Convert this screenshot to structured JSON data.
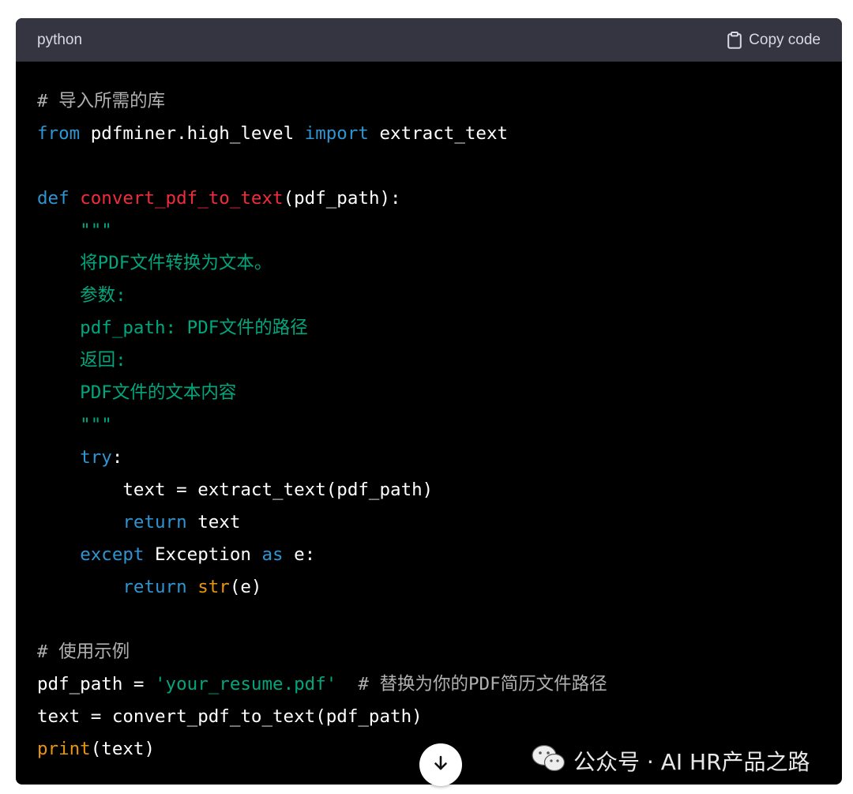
{
  "header": {
    "language": "python",
    "copy_label": "Copy code",
    "copy_icon": "clipboard-icon"
  },
  "code_lines": [
    [
      {
        "t": "# 导入所需的库",
        "c": "cm"
      }
    ],
    [
      {
        "t": "from",
        "c": "kw"
      },
      {
        "t": " pdfminer.high_level ",
        "c": ""
      },
      {
        "t": "import",
        "c": "kw"
      },
      {
        "t": " extract_text",
        "c": ""
      }
    ],
    [],
    [
      {
        "t": "def",
        "c": "kw"
      },
      {
        "t": " ",
        "c": ""
      },
      {
        "t": "convert_pdf_to_text",
        "c": "fn-def"
      },
      {
        "t": "(pdf_path):",
        "c": ""
      }
    ],
    [
      {
        "t": "    \"\"\"",
        "c": "str"
      }
    ],
    [
      {
        "t": "    将PDF文件转换为文本。",
        "c": "str"
      }
    ],
    [
      {
        "t": "    参数:",
        "c": "str"
      }
    ],
    [
      {
        "t": "    pdf_path: PDF文件的路径",
        "c": "str"
      }
    ],
    [
      {
        "t": "    返回:",
        "c": "str"
      }
    ],
    [
      {
        "t": "    PDF文件的文本内容",
        "c": "str"
      }
    ],
    [
      {
        "t": "    \"\"\"",
        "c": "str"
      }
    ],
    [
      {
        "t": "    ",
        "c": ""
      },
      {
        "t": "try",
        "c": "kw"
      },
      {
        "t": ":",
        "c": ""
      }
    ],
    [
      {
        "t": "        text = extract_text(pdf_path)",
        "c": ""
      }
    ],
    [
      {
        "t": "        ",
        "c": ""
      },
      {
        "t": "return",
        "c": "kw"
      },
      {
        "t": " text",
        "c": ""
      }
    ],
    [
      {
        "t": "    ",
        "c": ""
      },
      {
        "t": "except",
        "c": "kw"
      },
      {
        "t": " Exception ",
        "c": ""
      },
      {
        "t": "as",
        "c": "kw"
      },
      {
        "t": " e:",
        "c": ""
      }
    ],
    [
      {
        "t": "        ",
        "c": ""
      },
      {
        "t": "return",
        "c": "kw"
      },
      {
        "t": " ",
        "c": ""
      },
      {
        "t": "str",
        "c": "bi"
      },
      {
        "t": "(e)",
        "c": ""
      }
    ],
    [],
    [
      {
        "t": "# 使用示例",
        "c": "cm"
      }
    ],
    [
      {
        "t": "pdf_path = ",
        "c": ""
      },
      {
        "t": "'your_resume.pdf'",
        "c": "str"
      },
      {
        "t": "  ",
        "c": ""
      },
      {
        "t": "# 替换为你的PDF简历文件路径",
        "c": "cm"
      }
    ],
    [
      {
        "t": "text = convert_pdf_to_text(pdf_path)",
        "c": ""
      }
    ],
    [
      {
        "t": "print",
        "c": "bi"
      },
      {
        "t": "(text)",
        "c": ""
      }
    ]
  ],
  "scroll_button": {
    "icon": "arrow-down-icon"
  },
  "watermark": {
    "icon": "wechat-icon",
    "text": "公众号 · AI HR产品之路"
  },
  "colors": {
    "header_bg": "#343541",
    "code_bg": "#000000",
    "keyword": "#2e95d3",
    "function": "#f22c3d",
    "string": "#00a67d",
    "comment": "#b0b0b0",
    "builtin": "#e9950c"
  }
}
